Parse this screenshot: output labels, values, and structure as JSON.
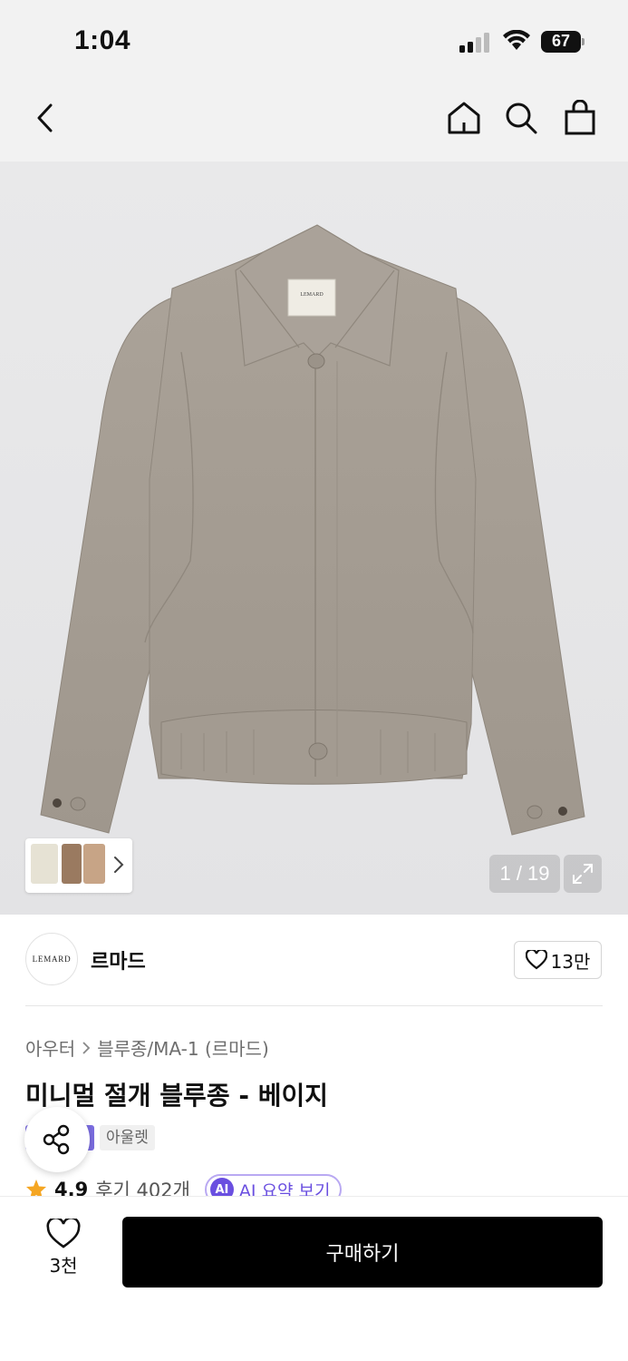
{
  "status_bar": {
    "time": "1:04",
    "battery": "67"
  },
  "nav": {
    "back_icon": "chevron-left-icon",
    "home_icon": "home-icon",
    "search_icon": "search-icon",
    "bag_icon": "shopping-bag-icon"
  },
  "gallery": {
    "counter": "1 / 19",
    "expand_icon": "expand-icon",
    "jacket_label": "LEMARD"
  },
  "brand": {
    "logo_text": "LEMARD",
    "name": "르마드",
    "like_count": "13만"
  },
  "product": {
    "breadcrumb": [
      "아우터",
      "블루종/MA-1 (르마드)"
    ],
    "title": "미니멀 절개 블루종 - 베이지",
    "badge_outlet": "아울렛",
    "rating": "4.9",
    "review_count": "후기 402개",
    "ai_label": "AI",
    "ai_summary": "AI 요약 보기"
  },
  "bottom": {
    "wish_count": "3천",
    "buy_label": "구매하기"
  },
  "colors": {
    "background": "#f2f2f2",
    "jacket": "#a59d93",
    "ai_accent": "#6a4fe0",
    "star": "#f5a623",
    "buy_button": "#000000"
  }
}
